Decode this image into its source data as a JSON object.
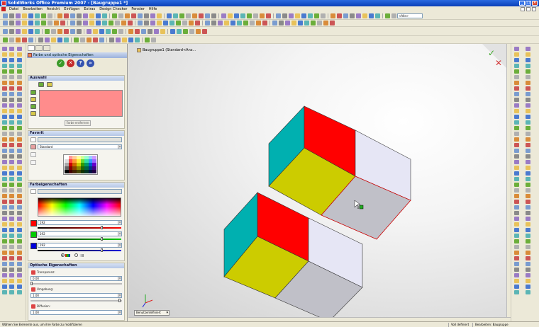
{
  "window": {
    "title": "SolidWorks Office Premium 2007 - [Baugruppe1 *]"
  },
  "menu": [
    "Datei",
    "Bearbeiten",
    "Ansicht",
    "Einfügen",
    "Extras",
    "Design Checker",
    "Fenster",
    "Hilfe"
  ],
  "toolbar": {
    "zoom_combo": "<Alle>"
  },
  "property_manager": {
    "title": "Farbe und optische Eigenschaften",
    "sections": {
      "selection": {
        "title": "Auswahl",
        "remove_colors_button": "Farbe entfernen"
      },
      "color": {
        "title": "Favorit",
        "standard_value": "Standard"
      },
      "color_properties": {
        "title": "Farbeigenschaften",
        "red_value": "192",
        "green_value": "192",
        "blue_value": "192",
        "channel_colors": {
          "red": "#ff0000",
          "green": "#00cc00",
          "blue": "#0000dd"
        }
      },
      "optical": {
        "title": "Optische Eigenschaften",
        "transparency_label": "Transparenz:",
        "transparency_value": "0.00",
        "ambient_label": "Umgebung:",
        "ambient_value": "1.00",
        "diffuse_label": "Diffusion:",
        "diffuse_value": "1.00"
      }
    }
  },
  "viewport": {
    "tree_label": "Baugruppe1 (Standard<Anz...",
    "view_tab_label": "Benutzerdefiniert",
    "face_colors": {
      "red": "#ff0000",
      "yellow": "#cccc00",
      "teal": "#00b0b0",
      "lavender": "#e6e6f5",
      "gray": "#c0c0c8",
      "outline": "#333333",
      "selected": "#cc0000"
    }
  },
  "statusbar": {
    "message": "Wählen Sie Elemente aus, um ihre Farbe zu modifizieren",
    "definition": "Voll definiert",
    "editing": "Bearbeiten: Baugruppe"
  }
}
